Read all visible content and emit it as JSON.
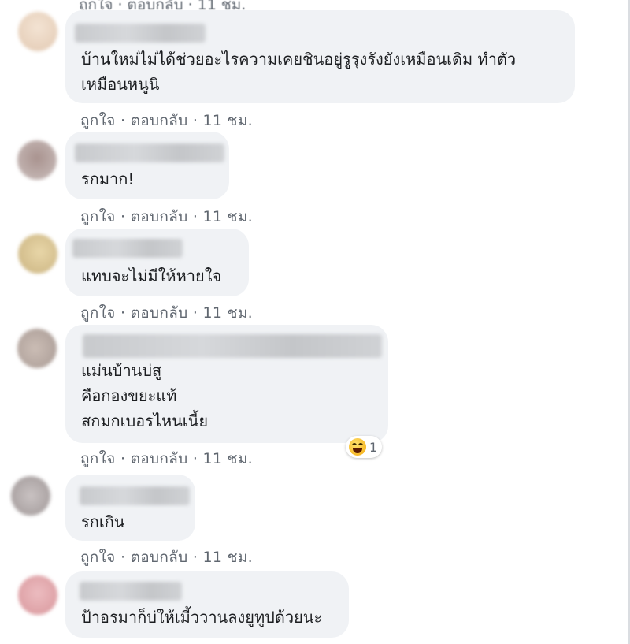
{
  "top_strip": "ถูกใจ · ตอบกลับ · 11 ชม.",
  "actions": {
    "like": "ถูกใจ",
    "reply": "ตอบกลับ",
    "time": "11 ชม.",
    "sep": " · "
  },
  "comments": [
    {
      "text": "บ้านใหม่ไม่ได้ช่วยอะไรความเคยชินอยู่รูรุงรังยังเหมือนเดิม ทำตัว\nเหมือนหนูนิ",
      "avatar_color": "#e8d5c2"
    },
    {
      "text": "รกมาก!",
      "avatar_color": "#b9a9a6"
    },
    {
      "text": "แทบจะไม่มีให้หายใจ",
      "avatar_color": "#d9c49a"
    },
    {
      "text": "แม่นบ้านบ่สู\nคือกองขยะแท้\nสกมกเบอรไหนเนี้ย",
      "avatar_color": "#c0b6b0",
      "reaction": {
        "emoji": "laughing-emoji",
        "count": "1"
      }
    },
    {
      "text": "รกเกิน",
      "avatar_color": "#b4aeae"
    },
    {
      "text": "ป้าอรมาก็บ่ให้เมี้ววานลงยูทูปด้วยนะ",
      "avatar_color": "#e0a9ad"
    }
  ]
}
